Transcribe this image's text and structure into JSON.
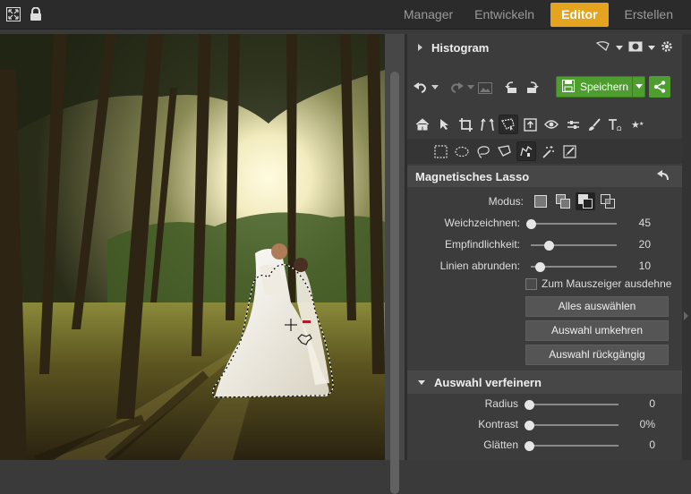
{
  "topbar": {
    "icons": [
      "fullscreen-icon",
      "lock-icon"
    ],
    "tabs": [
      {
        "label": "Manager",
        "active": false
      },
      {
        "label": "Entwickeln",
        "active": false
      },
      {
        "label": "Editor",
        "active": true
      },
      {
        "label": "Erstellen",
        "active": false
      }
    ]
  },
  "histogram": {
    "title": "Histogram"
  },
  "toolbar": {
    "save_label": "Speichern"
  },
  "lasso": {
    "title": "Magnetisches Lasso",
    "mode_label": "Modus:",
    "sliders": [
      {
        "label": "Weichzeichnen:",
        "value": "45",
        "fraction": 0.0
      },
      {
        "label": "Empfindlichkeit:",
        "value": "20",
        "fraction": 0.21
      },
      {
        "label": "Linien abrunden:",
        "value": "10",
        "fraction": 0.1
      }
    ],
    "checkbox_label": "Zum Mauszeiger ausdehne",
    "buttons": [
      "Alles auswählen",
      "Auswahl umkehren",
      "Auswahl rückgängig"
    ]
  },
  "refine": {
    "title": "Auswahl verfeinern",
    "sliders": [
      {
        "label": "Radius",
        "value": "0",
        "fraction": 0.0
      },
      {
        "label": "Kontrast",
        "value": "0%",
        "fraction": 0.0
      },
      {
        "label": "Glätten",
        "value": "0",
        "fraction": 0.0
      }
    ]
  },
  "colors": {
    "accent": "#e4a41f",
    "save": "#4e9e2f"
  }
}
